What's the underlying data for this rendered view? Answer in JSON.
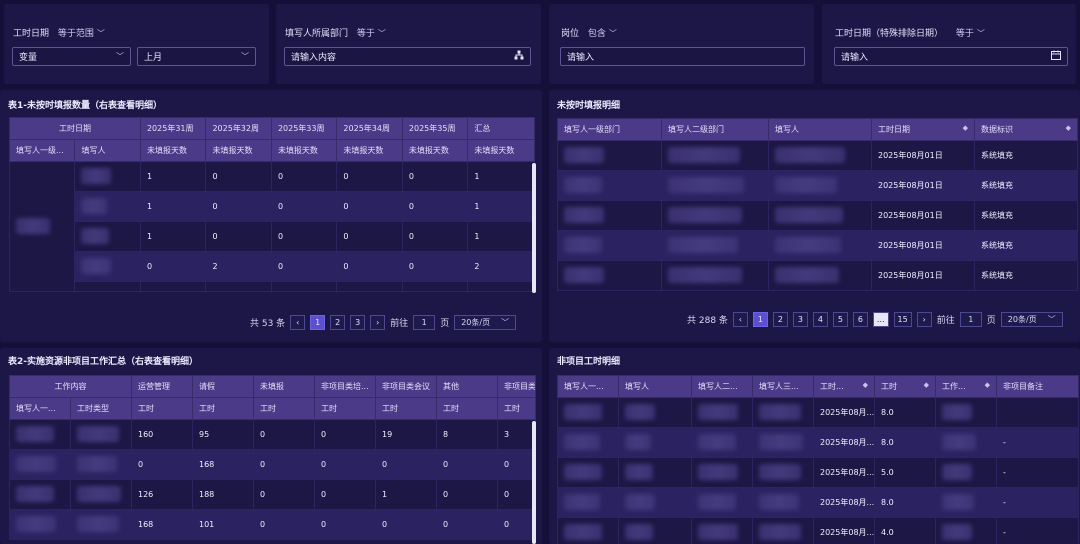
{
  "filters": {
    "f1": {
      "label": "工时日期",
      "op": "等于范围",
      "select1": "变量",
      "select2": "上月"
    },
    "f2": {
      "label": "填写人所属部门",
      "op": "等于",
      "placeholder": "请输入内容"
    },
    "f3": {
      "label": "岗位",
      "op": "包含",
      "placeholder": "请输入"
    },
    "f4": {
      "label": "工时日期（特殊排除日期）",
      "op": "等于",
      "placeholder": "请输入"
    }
  },
  "table1": {
    "title": "表1-未按时填报数量（右表查看明细）",
    "group_header": "工时日期",
    "weeks": [
      "2025年31周",
      "2025年32周",
      "2025年33周",
      "2025年34周",
      "2025年35周",
      "汇总"
    ],
    "sub_headers": [
      "填写人一级...",
      "填写人",
      "未填报天数",
      "未填报天数",
      "未填报天数",
      "未填报天数",
      "未填报天数",
      "未填报天数"
    ],
    "rows": [
      [
        "1",
        "0",
        "0",
        "0",
        "0",
        "1"
      ],
      [
        "1",
        "0",
        "0",
        "0",
        "0",
        "1"
      ],
      [
        "1",
        "0",
        "0",
        "0",
        "0",
        "1"
      ],
      [
        "0",
        "2",
        "0",
        "0",
        "0",
        "2"
      ]
    ],
    "pager": {
      "total": "共 53 条",
      "pages": [
        "1",
        "2",
        "3"
      ],
      "goto": "前往",
      "goto_value": "1",
      "page_unit": "页",
      "size": "20条/页"
    }
  },
  "table2": {
    "title": "未按时填报明细",
    "headers": [
      "填写人一级部门",
      "填写人二级部门",
      "填写人",
      "工时日期",
      "数据标识"
    ],
    "rows": [
      [
        "2025年08月01日",
        "系统填充"
      ],
      [
        "2025年08月01日",
        "系统填充"
      ],
      [
        "2025年08月01日",
        "系统填充"
      ],
      [
        "2025年08月01日",
        "系统填充"
      ],
      [
        "2025年08月01日",
        "系统填充"
      ]
    ],
    "pager": {
      "total": "共 288 条",
      "pages": [
        "1",
        "2",
        "3",
        "4",
        "5",
        "6",
        "...",
        "15"
      ],
      "goto": "前往",
      "goto_value": "1",
      "page_unit": "页",
      "size": "20条/页"
    }
  },
  "table3": {
    "title": "表2-实施资源非项目工作汇总（右表查看明细）",
    "group_header": "工作内容",
    "categories": [
      "运营管理",
      "请假",
      "未填报",
      "非项目类培...",
      "非项目类会议",
      "其他",
      "非项目类"
    ],
    "sub_headers": [
      "填写人一...",
      "工时类型",
      "工时",
      "工时",
      "工时",
      "工时",
      "工时",
      "工时",
      "工时"
    ],
    "rows": [
      [
        "160",
        "95",
        "0",
        "0",
        "19",
        "8",
        "3"
      ],
      [
        "0",
        "168",
        "0",
        "0",
        "0",
        "0",
        "0"
      ],
      [
        "126",
        "188",
        "0",
        "0",
        "1",
        "0",
        "0"
      ],
      [
        "168",
        "101",
        "0",
        "0",
        "0",
        "0",
        "0"
      ]
    ]
  },
  "table4": {
    "title": "非项目工时明细",
    "headers": [
      "填写人一...",
      "填写人",
      "填写人二...",
      "填写人三...",
      "工时...",
      "工时",
      "工作...",
      "非项目备注"
    ],
    "rows": [
      [
        "2025年08月...",
        "8.0",
        ""
      ],
      [
        "2025年08月...",
        "8.0",
        "-"
      ],
      [
        "2025年08月...",
        "5.0",
        "-"
      ],
      [
        "2025年08月...",
        "8.0",
        "-"
      ],
      [
        "2025年08月...",
        "4.0",
        "-"
      ]
    ]
  }
}
